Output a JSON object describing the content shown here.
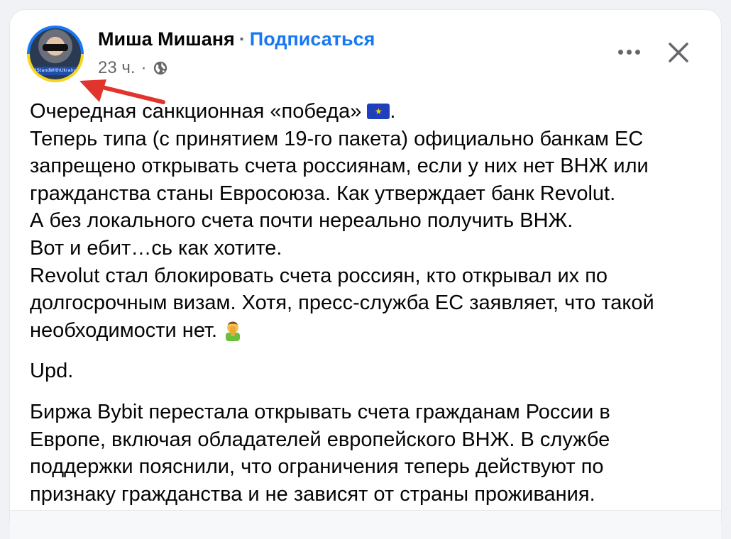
{
  "post": {
    "author": "Миша Мишаня",
    "separator": "·",
    "follow_label": "Подписаться",
    "time": "23 ч.",
    "avatar_ribbon": "#StandWithUkraine",
    "lines": [
      "Очередная санкционная «победа»",
      "Теперь типа (с принятием 19-го пакета) официально банкам ЕС",
      "запрещено открывать счета россиянам, если у них нет ВНЖ или",
      "гражданства станы Евросоюза. Как утверждает банк Revolut.",
      "А без локального счета почти нереально получить ВНЖ.",
      "Вот и ебит…сь как хотите.",
      "Revolut стал блокировать счета россиян, кто открывал их по",
      "долгосрочным визам. Хотя, пресс-служба ЕС заявляет, что такой",
      "необходимости нет."
    ],
    "line1_suffix": ".",
    "upd": "Upd.",
    "update_lines": [
      "Биржа Bybit перестала открывать счета гражданам России в",
      "Европе, включая обладателей европейского ВНЖ. В службе",
      "поддержки пояснили, что ограничения теперь действуют по",
      "признаку гражданства и не зависят от страны проживания."
    ]
  },
  "icons": {
    "globe": "globe-icon",
    "more": "more-icon",
    "close": "close-icon",
    "flag": "eu-flag-emoji",
    "facepalm": "facepalm-emoji",
    "arrow": "red-arrow-annotation"
  },
  "colors": {
    "link": "#1877f2",
    "meta": "#65676b",
    "arrow": "#e0342c"
  }
}
